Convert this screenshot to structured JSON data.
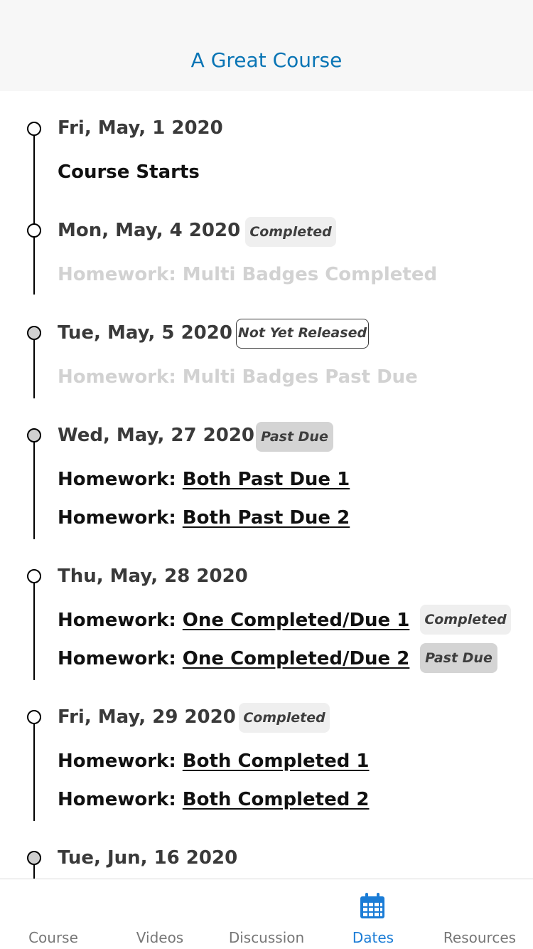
{
  "header": {
    "title": "A Great Course"
  },
  "dates": [
    {
      "date": "Fri, May, 1 2020",
      "items": [
        {
          "text": "Course Starts"
        }
      ]
    },
    {
      "date": "Mon, May, 4 2020",
      "badge": "Completed",
      "items": [
        {
          "prefix": "Homework: ",
          "text": "Multi Badges Completed"
        }
      ]
    },
    {
      "date": "Tue, May, 5 2020",
      "badge": "Not Yet Released",
      "items": [
        {
          "prefix": "Homework: ",
          "text": "Multi Badges Past Due"
        }
      ]
    },
    {
      "date": "Wed, May, 27 2020",
      "badge": "Past Due",
      "items": [
        {
          "prefix": "Homework: ",
          "text": "Both Past Due 1"
        },
        {
          "prefix": "Homework: ",
          "text": "Both Past Due 2"
        }
      ]
    },
    {
      "date": "Thu, May, 28 2020",
      "items": [
        {
          "prefix": "Homework: ",
          "text": "One Completed/Due 1",
          "badge": "Completed"
        },
        {
          "prefix": "Homework: ",
          "text": "One Completed/Due 2",
          "badge": "Past Due"
        }
      ]
    },
    {
      "date": "Fri, May, 29 2020",
      "badge": "Completed",
      "items": [
        {
          "prefix": "Homework: ",
          "text": "Both Completed 1"
        },
        {
          "prefix": "Homework: ",
          "text": "Both Completed 2"
        }
      ]
    },
    {
      "date": "Tue, Jun, 16 2020",
      "items": []
    }
  ],
  "tabs": [
    {
      "label": "Course",
      "icon": "course-icon"
    },
    {
      "label": "Videos",
      "icon": "videos-icon"
    },
    {
      "label": "Discussion",
      "icon": "discussion-icon"
    },
    {
      "label": "Dates",
      "icon": "calendar-icon",
      "active": true
    },
    {
      "label": "Resources",
      "icon": "resources-icon"
    }
  ],
  "colors": {
    "accent": "#0a75b5",
    "tab_active": "#1a7cd6",
    "header_bg": "#f7f7f7"
  }
}
